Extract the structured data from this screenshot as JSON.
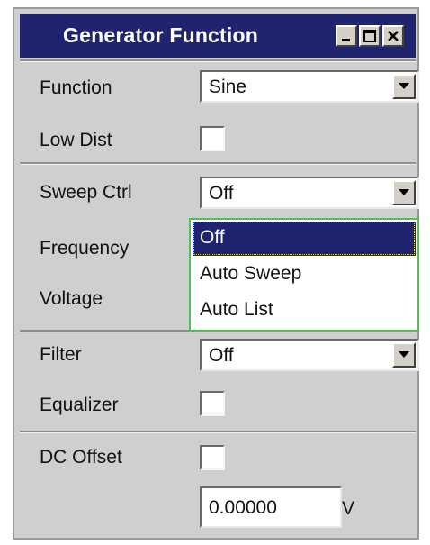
{
  "window": {
    "title": "Generator Function",
    "buttons": {
      "minimize": "minimize-icon",
      "maximize": "maximize-icon",
      "close": "close-icon"
    }
  },
  "function": {
    "label": "Function",
    "value": "Sine"
  },
  "low_dist": {
    "label": "Low Dist",
    "checked": false
  },
  "sweep_ctrl": {
    "label": "Sweep Ctrl",
    "value": "Off",
    "options": [
      "Off",
      "Auto Sweep",
      "Auto List"
    ],
    "highlighted": "Off"
  },
  "frequency": {
    "label": "Frequency"
  },
  "voltage": {
    "label": "Voltage"
  },
  "filter": {
    "label": "Filter",
    "value": "Off"
  },
  "equalizer": {
    "label": "Equalizer",
    "checked": false
  },
  "dc_offset": {
    "label": "DC Offset",
    "checked": false,
    "value": "0.00000",
    "unit": "V"
  },
  "colors": {
    "title_bar": "#1f2370",
    "panel": "#cfcfcf",
    "dropdown_border": "#55c05a"
  }
}
